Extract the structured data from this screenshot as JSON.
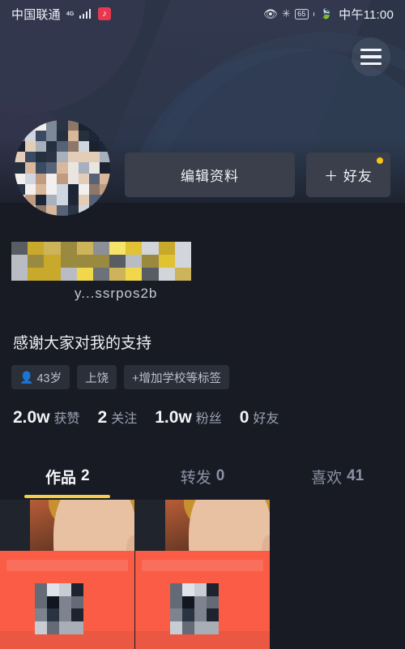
{
  "status_bar": {
    "carrier": "中国联通",
    "network": "4G",
    "app_badge_icon": "douyin-icon",
    "eye_icon": "eye-care-icon",
    "bluetooth_icon": "bluetooth-icon",
    "battery_level": "65",
    "leaf_icon": "power-saving-leaf-icon",
    "time": "中午11:00"
  },
  "header": {
    "menu_icon": "hamburger-menu-icon",
    "cover_color": "#2c3547"
  },
  "profile": {
    "avatar_icon": "user-avatar-censored",
    "edit_button_label": "编辑资料",
    "friend_button_label": "＋ 好友",
    "friend_button_badge": "new-notification-dot",
    "badge_color": "#f5c518",
    "display_name_censored": "username-censored",
    "user_id_partial": "y...ssrpos2b",
    "bio": "感谢大家对我的支持"
  },
  "tags": [
    {
      "icon": "person-icon",
      "label": "43岁"
    },
    {
      "icon": "",
      "label": "上饶"
    },
    {
      "icon": "",
      "label": "+增加学校等标签"
    }
  ],
  "stats": [
    {
      "value": "2.0w",
      "label": "获赞"
    },
    {
      "value": "2",
      "label": "关注"
    },
    {
      "value": "1.0w",
      "label": "粉丝"
    },
    {
      "value": "0",
      "label": "好友"
    }
  ],
  "tabs": [
    {
      "label": "作品",
      "count": "2",
      "active": true
    },
    {
      "label": "转发",
      "count": "0",
      "active": false
    },
    {
      "label": "喜欢",
      "count": "41",
      "active": false
    }
  ],
  "tab_accent_color": "#f3cd4b",
  "grid": {
    "items": [
      {
        "name": "video-thumbnail-1",
        "overlay_color": "#fa5c46"
      },
      {
        "name": "video-thumbnail-2",
        "overlay_color": "#fa5c46"
      }
    ],
    "empty_cell": "empty-grid-slot"
  }
}
